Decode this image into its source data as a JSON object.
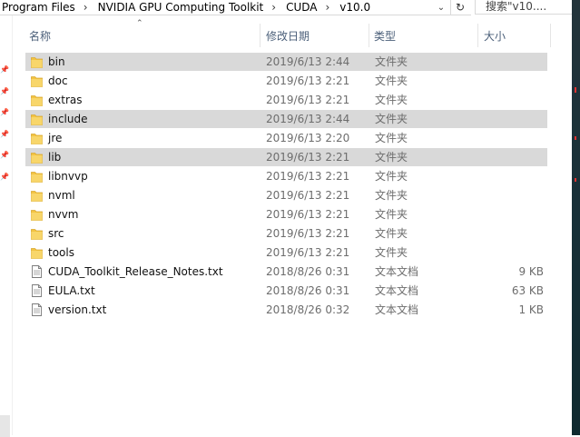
{
  "address_bar": {
    "crumbs": [
      "Program Files",
      "NVIDIA GPU Computing Toolkit",
      "CUDA",
      "v10.0"
    ],
    "search_placeholder": "搜索\"v10...."
  },
  "columns": {
    "name": "名称",
    "date": "修改日期",
    "type": "类型",
    "size": "大小"
  },
  "colors": {
    "selected_row": "#d9d9d9",
    "folder": "#f3c443",
    "header_text": "#4c607a"
  },
  "files": [
    {
      "name": "bin",
      "date": "2019/6/13 2:44",
      "type": "文件夹",
      "size": "",
      "icon": "folder-icon",
      "selected": true
    },
    {
      "name": "doc",
      "date": "2019/6/13 2:21",
      "type": "文件夹",
      "size": "",
      "icon": "folder-icon",
      "selected": false
    },
    {
      "name": "extras",
      "date": "2019/6/13 2:21",
      "type": "文件夹",
      "size": "",
      "icon": "folder-icon",
      "selected": false
    },
    {
      "name": "include",
      "date": "2019/6/13 2:44",
      "type": "文件夹",
      "size": "",
      "icon": "folder-icon",
      "selected": true
    },
    {
      "name": "jre",
      "date": "2019/6/13 2:20",
      "type": "文件夹",
      "size": "",
      "icon": "folder-icon",
      "selected": false
    },
    {
      "name": "lib",
      "date": "2019/6/13 2:21",
      "type": "文件夹",
      "size": "",
      "icon": "folder-icon",
      "selected": true
    },
    {
      "name": "libnvvp",
      "date": "2019/6/13 2:21",
      "type": "文件夹",
      "size": "",
      "icon": "folder-icon",
      "selected": false
    },
    {
      "name": "nvml",
      "date": "2019/6/13 2:21",
      "type": "文件夹",
      "size": "",
      "icon": "folder-icon",
      "selected": false
    },
    {
      "name": "nvvm",
      "date": "2019/6/13 2:21",
      "type": "文件夹",
      "size": "",
      "icon": "folder-icon",
      "selected": false
    },
    {
      "name": "src",
      "date": "2019/6/13 2:21",
      "type": "文件夹",
      "size": "",
      "icon": "folder-icon",
      "selected": false
    },
    {
      "name": "tools",
      "date": "2019/6/13 2:21",
      "type": "文件夹",
      "size": "",
      "icon": "folder-icon",
      "selected": false
    },
    {
      "name": "CUDA_Toolkit_Release_Notes.txt",
      "date": "2018/8/26 0:31",
      "type": "文本文档",
      "size": "9 KB",
      "icon": "text-file-icon",
      "selected": false
    },
    {
      "name": "EULA.txt",
      "date": "2018/8/26 0:31",
      "type": "文本文档",
      "size": "63 KB",
      "icon": "text-file-icon",
      "selected": false
    },
    {
      "name": "version.txt",
      "date": "2018/8/26 0:32",
      "type": "文本文档",
      "size": "1 KB",
      "icon": "text-file-icon",
      "selected": false
    }
  ]
}
